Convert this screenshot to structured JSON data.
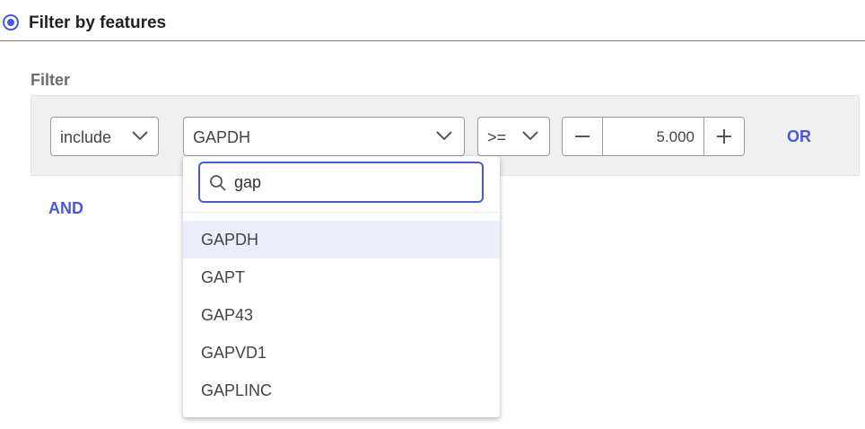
{
  "header": {
    "title": "Filter by features"
  },
  "filter": {
    "section_label": "Filter",
    "include_value": "include",
    "feature_value": "GAPDH",
    "operator_value": ">=",
    "threshold_value": "5.000",
    "or_label": "OR",
    "and_label": "AND"
  },
  "dropdown": {
    "search_value": "gap",
    "options": [
      "GAPDH",
      "GAPT",
      "GAP43",
      "GAPVD1",
      "GAPLINC"
    ],
    "highlighted": "GAPDH"
  },
  "colors": {
    "accent": "#4a56e2",
    "highlight": "#ebedf9",
    "row_bg": "#f0f0f0"
  },
  "icons": [
    "radio-selected-icon",
    "chevron-down-icon",
    "minus-icon",
    "plus-icon",
    "search-icon"
  ]
}
